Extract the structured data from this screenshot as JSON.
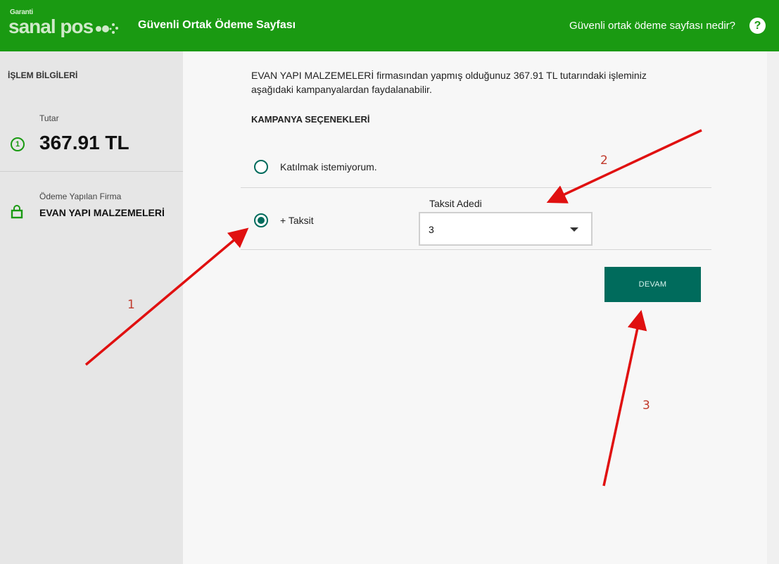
{
  "header": {
    "logo_small": "Garanti",
    "logo_main": "sanal pos",
    "title": "Güvenli Ortak Ödeme Sayfası",
    "help_link": "Güvenli ortak ödeme sayfası nedir?",
    "help_icon": "?"
  },
  "sidebar": {
    "heading": "İŞLEM BİLGİLERİ",
    "amount_label": "Tutar",
    "amount_icon_text": "1",
    "amount_value": "367.91 TL",
    "firm_label": "Ödeme Yapılan Firma",
    "firm_value": "EVAN YAPI MALZEMELERİ"
  },
  "main": {
    "intro": "EVAN YAPI MALZEMELERİ firmasından yapmış olduğunuz 367.91 TL tutarındaki işleminiz aşağıdaki kampanyalardan faydalanabilir.",
    "section_title": "KAMPANYA SEÇENEKLERİ",
    "options": [
      {
        "label": "Katılmak istemiyorum.",
        "selected": false
      },
      {
        "label": "+ Taksit",
        "selected": true
      }
    ],
    "installment": {
      "label": "Taksit Adedi",
      "selected_value": "3"
    },
    "continue_button": "DEVAM"
  },
  "annotations": {
    "labels": [
      "1",
      "2",
      "3"
    ],
    "color": "#e01010"
  },
  "colors": {
    "header_bg": "#1a9a12",
    "accent": "#006b5c",
    "sidebar_bg": "#e6e6e6"
  }
}
